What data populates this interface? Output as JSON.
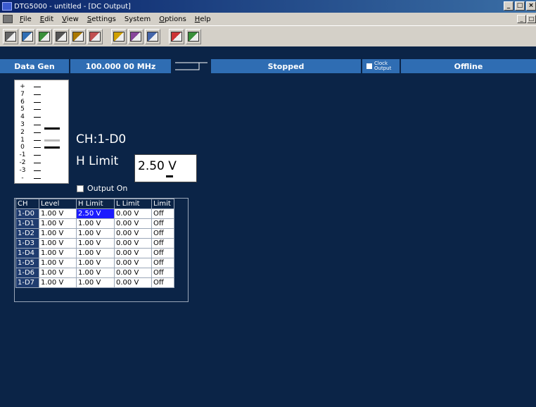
{
  "window": {
    "title": "DTG5000 - untitled - [DC Output]"
  },
  "menu": {
    "items": [
      {
        "label": "File",
        "underline": "F",
        "rest": "ile"
      },
      {
        "label": "Edit",
        "underline": "E",
        "rest": "dit"
      },
      {
        "label": "View",
        "underline": "V",
        "rest": "iew"
      },
      {
        "label": "Settings",
        "underline": "S",
        "rest": "ettings"
      },
      {
        "label": "System",
        "underline": "",
        "rest": "System"
      },
      {
        "label": "Options",
        "underline": "O",
        "rest": "ptions"
      },
      {
        "label": "Help",
        "underline": "H",
        "rest": "elp"
      }
    ]
  },
  "window_buttons": {
    "minimize": "_",
    "restore": "□",
    "close": "×"
  },
  "toolbar": {
    "icons": [
      "print-icon",
      "setup-icon",
      "monitor-icon",
      "pattern-icon",
      "timing-icon",
      "waveform-icon",
      "warning-icon",
      "data-icon",
      "grid-icon",
      "mixer-icon",
      "dc-output-icon"
    ]
  },
  "status": {
    "mode": "Data Gen",
    "frequency": "100.000 00 MHz",
    "run_state": "Stopped",
    "clock_output": "Clock Output",
    "connection": "Offline"
  },
  "scale": {
    "ticks": [
      "+",
      "7",
      "6",
      "5",
      "4",
      "3",
      "2",
      "1",
      "0",
      "-1",
      "-2",
      "-3",
      "-"
    ]
  },
  "detail": {
    "channel": "CH:1-D0",
    "parameter": "H Limit",
    "value": "2.50 V",
    "output_on_label": "Output On",
    "output_on_checked": false
  },
  "table": {
    "headers": [
      "CH",
      "Level",
      "H Limit",
      "L Limit",
      "Limit"
    ],
    "rows": [
      [
        "1-D0",
        "1.00 V",
        "2.50 V",
        "0.00 V",
        "Off"
      ],
      [
        "1-D1",
        "1.00 V",
        "1.00 V",
        "0.00 V",
        "Off"
      ],
      [
        "1-D2",
        "1.00 V",
        "1.00 V",
        "0.00 V",
        "Off"
      ],
      [
        "1-D3",
        "1.00 V",
        "1.00 V",
        "0.00 V",
        "Off"
      ],
      [
        "1-D4",
        "1.00 V",
        "1.00 V",
        "0.00 V",
        "Off"
      ],
      [
        "1-D5",
        "1.00 V",
        "1.00 V",
        "0.00 V",
        "Off"
      ],
      [
        "1-D6",
        "1.00 V",
        "1.00 V",
        "0.00 V",
        "Off"
      ],
      [
        "1-D7",
        "1.00 V",
        "1.00 V",
        "0.00 V",
        "Off"
      ]
    ],
    "selected_row": 0,
    "selected_col": 2
  },
  "colors": {
    "background": "#0b2447",
    "status_blue": "#2f6db3",
    "selection": "#1b1bff"
  }
}
